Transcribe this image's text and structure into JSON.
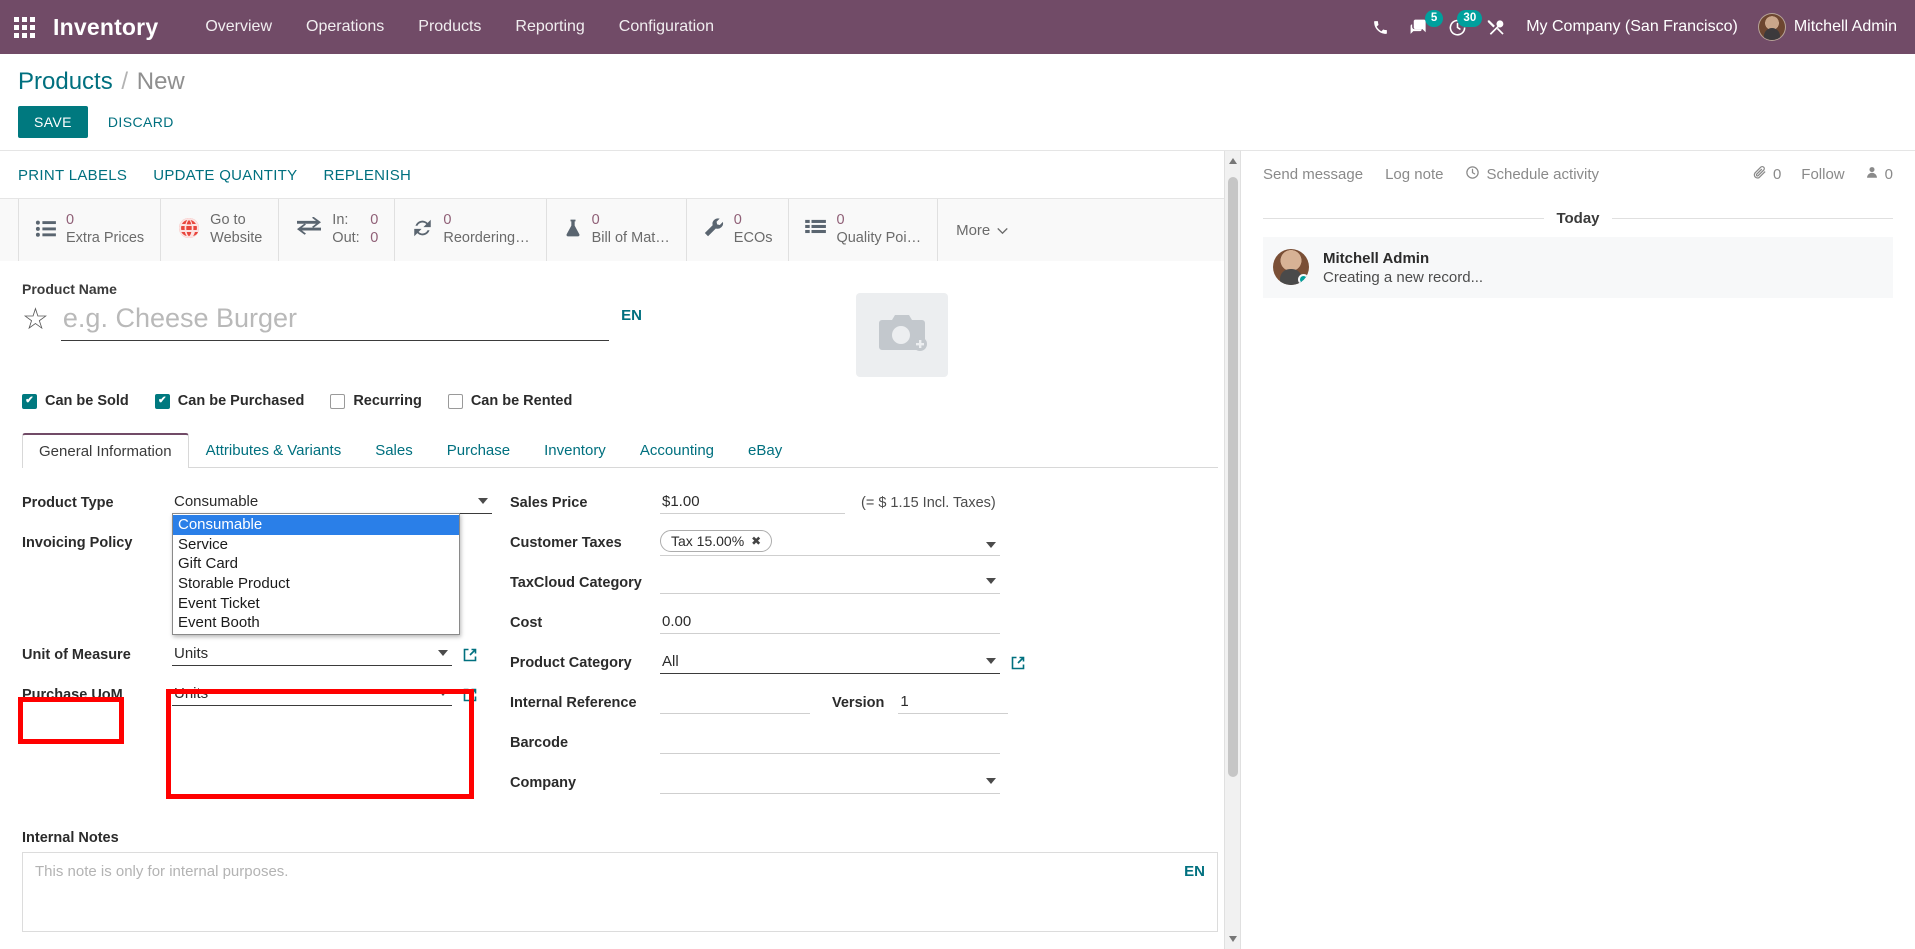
{
  "navbar": {
    "app_title": "Inventory",
    "menus": [
      "Overview",
      "Operations",
      "Products",
      "Reporting",
      "Configuration"
    ],
    "icons": [
      "phone-icon",
      "messages-icon",
      "activities-icon",
      "tools-icon"
    ],
    "messages_count": "5",
    "activities_count": "30",
    "company": "My Company (San Francisco)",
    "user": "Mitchell Admin",
    "accent_color": "#714B67",
    "badge_color": "#00A09D"
  },
  "breadcrumb": {
    "root": "Products",
    "separator": "/",
    "current": "New"
  },
  "actions": {
    "save": "SAVE",
    "discard": "DISCARD"
  },
  "statusbar_buttons": [
    "PRINT LABELS",
    "UPDATE QUANTITY",
    "REPLENISH"
  ],
  "smart_buttons": [
    {
      "icon": "list-icon",
      "value": "0",
      "label": "Extra Prices"
    },
    {
      "icon": "globe-icon",
      "value": "",
      "label": "Go to",
      "label2": "Website"
    },
    {
      "icon": "transfer-icon",
      "in_key": "In:",
      "in_val": "0",
      "out_key": "Out:",
      "out_val": "0"
    },
    {
      "icon": "refresh-icon",
      "value": "0",
      "label": "Reordering…"
    },
    {
      "icon": "flask-icon",
      "value": "0",
      "label": "Bill of Mat…"
    },
    {
      "icon": "wrench-icon",
      "value": "0",
      "label": "ECOs"
    },
    {
      "icon": "list-icon",
      "value": "0",
      "label": "Quality Poi…"
    }
  ],
  "smart_more": "More",
  "product": {
    "name_label": "Product Name",
    "name_value": "",
    "name_placeholder": "e.g. Cheese Burger",
    "lang_tag": "EN",
    "checkboxes": [
      {
        "label": "Can be Sold",
        "checked": true
      },
      {
        "label": "Can be Purchased",
        "checked": true
      },
      {
        "label": "Recurring",
        "checked": false
      },
      {
        "label": "Can be Rented",
        "checked": false
      }
    ]
  },
  "tabs": [
    {
      "label": "General Information",
      "active": true
    },
    {
      "label": "Attributes & Variants",
      "active": false
    },
    {
      "label": "Sales",
      "active": false
    },
    {
      "label": "Purchase",
      "active": false
    },
    {
      "label": "Inventory",
      "active": false
    },
    {
      "label": "Accounting",
      "active": false
    },
    {
      "label": "eBay",
      "active": false
    }
  ],
  "left_fields": {
    "product_type_label": "Product Type",
    "product_type_value": "Consumable",
    "product_type_options": [
      "Consumable",
      "Service",
      "Gift Card",
      "Storable Product",
      "Event Ticket",
      "Event Booth"
    ],
    "product_type_selected": "Consumable",
    "invoicing_policy_label": "Invoicing Policy",
    "uom_label": "Unit of Measure",
    "uom_value": "Units",
    "purchase_uom_label": "Purchase UoM",
    "purchase_uom_value": "Units"
  },
  "right_fields": {
    "sales_price_label": "Sales Price",
    "sales_price_value": "$1.00",
    "sales_price_note": "(= $ 1.15 Incl. Taxes)",
    "customer_taxes_label": "Customer Taxes",
    "customer_taxes_tag": "Tax 15.00%",
    "taxcloud_label": "TaxCloud Category",
    "taxcloud_value": "",
    "cost_label": "Cost",
    "cost_value": "0.00",
    "product_category_label": "Product Category",
    "product_category_value": "All",
    "internal_reference_label": "Internal Reference",
    "internal_reference_value": "",
    "version_label": "Version",
    "version_value": "1",
    "barcode_label": "Barcode",
    "barcode_value": "",
    "company_label": "Company",
    "company_value": ""
  },
  "notes": {
    "label": "Internal Notes",
    "placeholder": "This note is only for internal purposes.",
    "lang_tag": "EN"
  },
  "highlight": {
    "color": "#FF0000",
    "targets": [
      "Product Type label",
      "Product Type dropdown"
    ]
  },
  "chatter": {
    "send_message": "Send message",
    "log_note": "Log note",
    "schedule_activity": "Schedule activity",
    "attachment_count": "0",
    "follow": "Follow",
    "followers_count": "0",
    "day_separator": "Today",
    "message_author": "Mitchell Admin",
    "message_body": "Creating a new record..."
  }
}
